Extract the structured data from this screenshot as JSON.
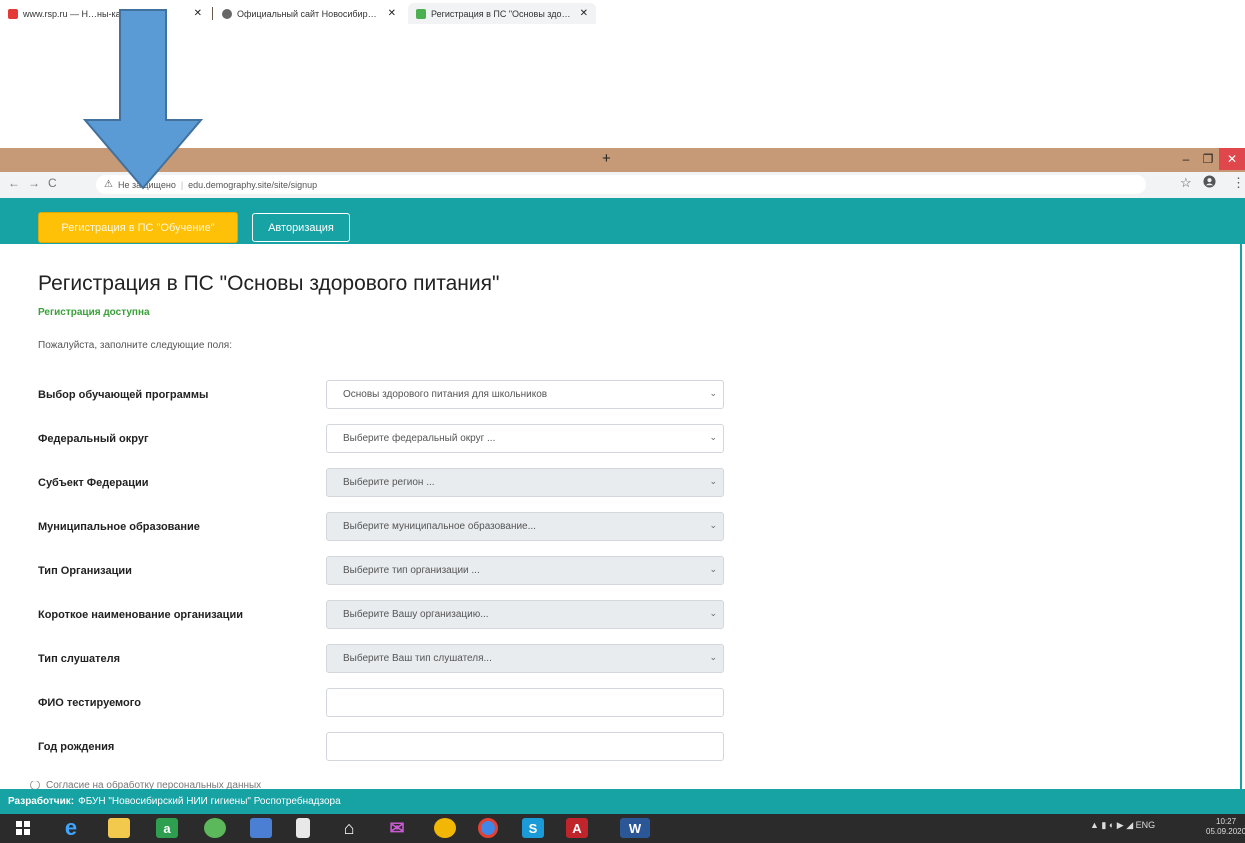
{
  "browser": {
    "tabs": [
      {
        "label": "www.rsp.ru — Н…ны-ка…",
        "favicon_color": "#e53935"
      },
      {
        "label": "Официальный сайт Новосибир…",
        "favicon_color": "#666666"
      },
      {
        "label": "Регистрация в ПС \"Основы здо…",
        "favicon_color": "#4caf50"
      }
    ],
    "new_tab": "+",
    "url_warning": "Не защищено",
    "url": "edu.demography.site/site/signup",
    "nav_back": "←",
    "nav_forward": "→",
    "nav_reload": "C",
    "star": "☆",
    "profile": "👤",
    "menu": "⋮",
    "win_minimize": "–",
    "win_maximize": "❐",
    "win_close": "✕"
  },
  "navbar": {
    "register_button": "Регистрация в ПС \"Обучение\"",
    "login_button": "Авторизация"
  },
  "page": {
    "title": "Регистрация в ПС \"Основы здорового питания\"",
    "status": "Регистрация доступна",
    "subtitle": "Пожалуйста, заполните следующие поля:",
    "fields": [
      {
        "label": "Выбор обучающей программы",
        "value": "Основы здорового питания для школьников",
        "disabled": false,
        "type": "select"
      },
      {
        "label": "Федеральный округ",
        "value": "Выберите федеральный округ ...",
        "disabled": false,
        "type": "select"
      },
      {
        "label": "Субъект Федерации",
        "value": "Выберите регион ...",
        "disabled": true,
        "type": "select"
      },
      {
        "label": "Муниципальное образование",
        "value": "Выберите муниципальное образование...",
        "disabled": true,
        "type": "select"
      },
      {
        "label": "Тип Организации",
        "value": "Выберите тип организации ...",
        "disabled": true,
        "type": "select"
      },
      {
        "label": "Короткое наименование организации",
        "value": "Выберите Вашу организацию...",
        "disabled": true,
        "type": "select"
      },
      {
        "label": "Тип слушателя",
        "value": "Выберите Ваш тип слушателя...",
        "disabled": true,
        "type": "select"
      },
      {
        "label": "ФИО тестируемого",
        "value": "",
        "disabled": false,
        "type": "input"
      },
      {
        "label": "Год рождения",
        "value": "",
        "disabled": false,
        "type": "input"
      }
    ],
    "consent": "Согласие на обработку персональных данных"
  },
  "footer": {
    "developer_label": "Разработчик:",
    "developer_text": "ФБУН \"Новосибирский НИИ гигиены\" Роспотребнадзора"
  },
  "taskbar": {
    "apps": [
      "windows-start",
      "ie",
      "explorer",
      "store",
      "utorrent",
      "monitor",
      "file",
      "home",
      "mail",
      "yandex",
      "chrome",
      "skype",
      "acrobat",
      "word"
    ],
    "tray_lang": "ENG",
    "clock_time": "10:27",
    "clock_date": "05.09.2020"
  },
  "colors": {
    "teal": "#17a2a4",
    "yellow": "#ffc107",
    "arrow": "#5b9bd5",
    "tab_bar": "#c69a76"
  }
}
